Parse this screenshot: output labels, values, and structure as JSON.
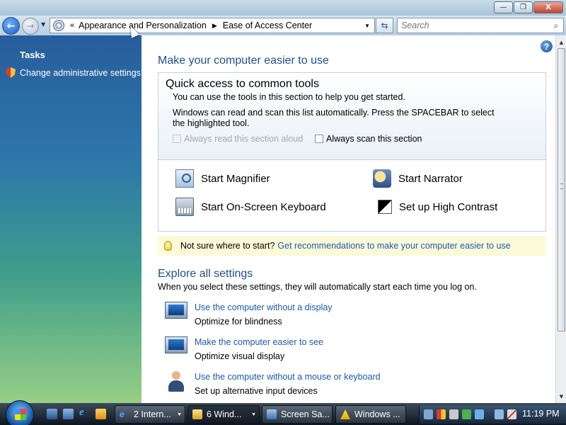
{
  "window": {
    "minimize_glyph": "—",
    "maximize_glyph": "❐",
    "close_glyph": "X"
  },
  "nav": {
    "back_glyph": "←",
    "forward_glyph": "→",
    "dropdown_glyph": "▼",
    "breadcrumb_chevron": "«",
    "breadcrumb_sep": "▶",
    "breadcrumb": [
      "Appearance and Personalization",
      "Ease of Access Center"
    ],
    "search_placeholder": "Search",
    "refresh_glyph": "⇆",
    "search_glyph": "⌕"
  },
  "sidebar": {
    "heading": "Tasks",
    "items": [
      {
        "label": "Change administrative settings",
        "icon": "shield-icon"
      }
    ]
  },
  "main": {
    "help_glyph": "?",
    "title": "Make your computer easier to use",
    "quick_access": {
      "title": "Quick access to common tools",
      "desc1": "You can use the tools in this section to help you get started.",
      "desc2": "Windows can read and scan this list automatically.  Press the SPACEBAR to select the highlighted tool.",
      "option_read_aloud": "Always read this section aloud",
      "option_scan": "Always scan this section",
      "tools": [
        {
          "label": "Start Magnifier",
          "icon": "magnifier-icon"
        },
        {
          "label": "Start Narrator",
          "icon": "narrator-icon"
        },
        {
          "label": "Start On-Screen Keyboard",
          "icon": "keyboard-icon"
        },
        {
          "label": "Set up High Contrast",
          "icon": "contrast-icon"
        }
      ]
    },
    "tip": {
      "text": "Not sure where to start?",
      "link": "Get recommendations to make your computer easier to use"
    },
    "explore": {
      "title": "Explore all settings",
      "desc": "When you select these settings, they will automatically start each time you log on.",
      "items": [
        {
          "link": "Use the computer without a display",
          "desc": "Optimize for blindness",
          "icon": "monitor-icon"
        },
        {
          "link": "Make the computer easier to see",
          "desc": "Optimize visual display",
          "icon": "monitor-magnifier-icon"
        },
        {
          "link": "Use the computer without a mouse or keyboard",
          "desc": "Set up alternative input devices",
          "icon": "person-icon"
        }
      ]
    }
  },
  "scrollbar": {
    "up_glyph": "▲",
    "down_glyph": "▼"
  },
  "taskbar": {
    "ie_glyph": "e",
    "arrow_glyph": "▼",
    "tasks": [
      {
        "label": "2 Intern...",
        "active": false
      },
      {
        "label": "6 Wind...",
        "active": true
      },
      {
        "label": "Screen Sa...",
        "active": false
      },
      {
        "label": "Windows ...",
        "active": false
      }
    ],
    "clock": "11:19 PM"
  }
}
